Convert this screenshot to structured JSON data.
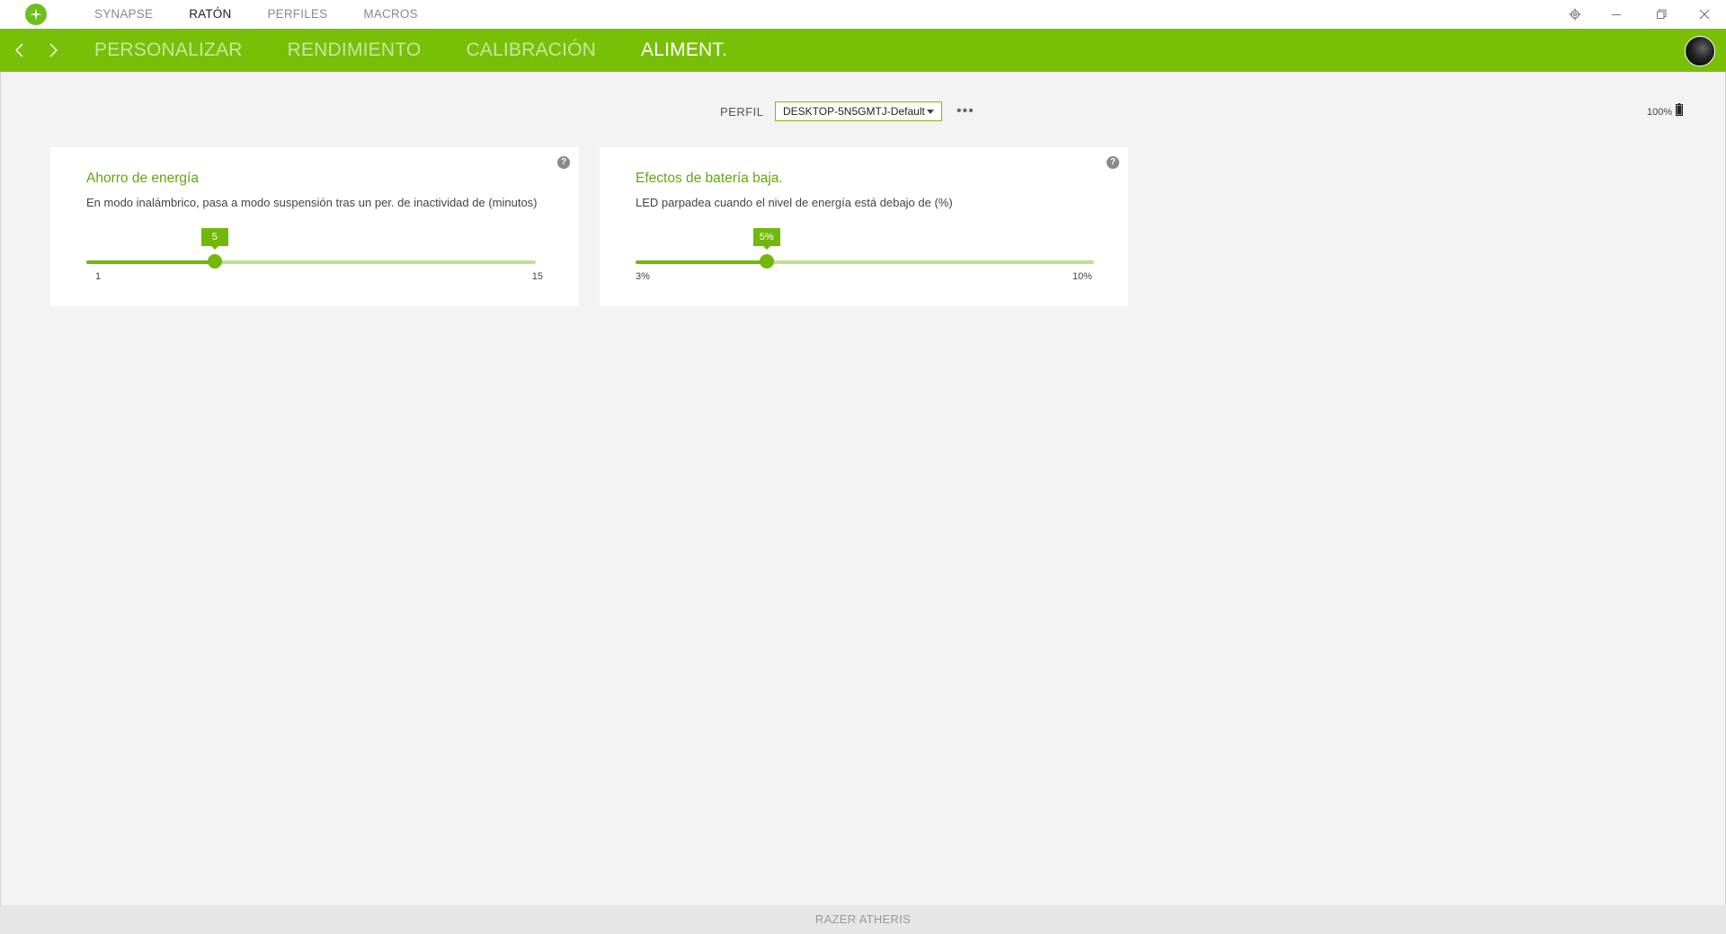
{
  "titlebar": {
    "tabs": [
      "SYNAPSE",
      "RATÓN",
      "PERFILES",
      "MACROS"
    ],
    "active_tab": "RATÓN",
    "icons": [
      "razer-logo-icon",
      "gear-icon",
      "minimize-icon",
      "restore-icon",
      "close-icon"
    ]
  },
  "navbar": {
    "tabs": [
      "PERSONALIZAR",
      "RENDIMIENTO",
      "CALIBRACIÓN",
      "ALIMENT."
    ],
    "active_tab": "ALIMENT.",
    "icons": [
      "back-arrow-icon",
      "forward-arrow-icon",
      "device-avatar"
    ]
  },
  "profile": {
    "label": "PERFIL",
    "selected": "DESKTOP-5N5GMTJ-Default",
    "more": "•••"
  },
  "battery": {
    "text": "100%",
    "level": 1.0
  },
  "cards": [
    {
      "title": "Ahorro de energía",
      "description": "En modo inalámbrico, pasa a modo suspensión tras un per. de inactividad de (minutos)",
      "value_label": "5",
      "value": 5,
      "min": 1,
      "max": 15,
      "min_label": "1",
      "max_label": "15",
      "help": "?"
    },
    {
      "title": "Efectos de batería baja.",
      "description": "LED parpadea cuando el nivel de energía está debajo de (%)",
      "value_label": "5%",
      "value": 5,
      "min": 3,
      "max": 10,
      "min_label": "3%",
      "max_label": "10%",
      "help": "?"
    }
  ],
  "footer": {
    "device_name": "RAZER ATHERIS"
  },
  "colors": {
    "accent": "#79bf08",
    "accent_dark": "#71b80a",
    "track": "#bfe28c",
    "title_green": "#5fa80c"
  }
}
